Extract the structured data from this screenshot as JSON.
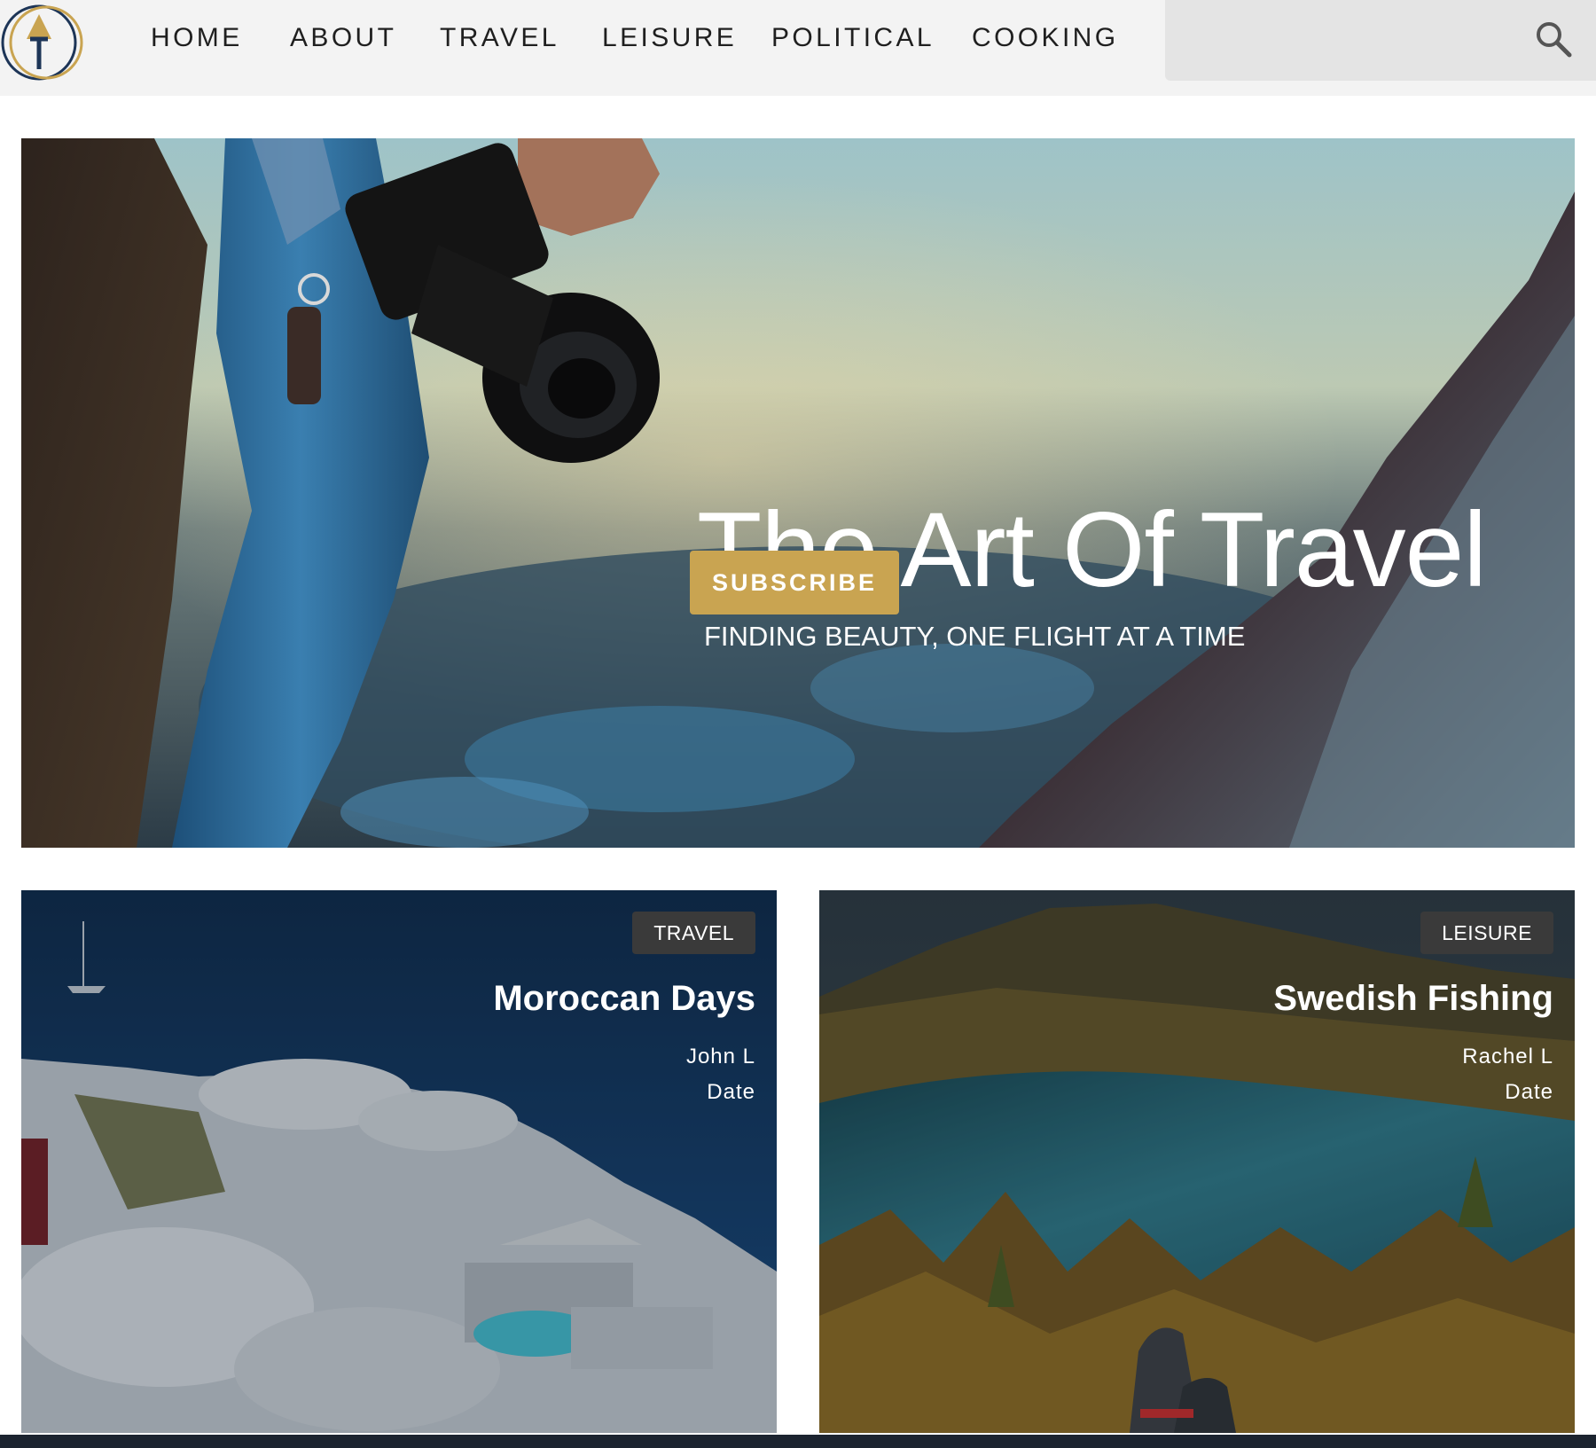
{
  "colors": {
    "accent_gold": "#c9a451",
    "logo_navy": "#1d3557",
    "nav_text": "#1f1f1f",
    "header_bg": "#f3f3f3",
    "search_bg": "#e4e4e4",
    "badge_bg": "#3a3a3a"
  },
  "header": {
    "logo_icon": "compass-t-logo",
    "nav": [
      {
        "label": "HOME"
      },
      {
        "label": "ABOUT"
      },
      {
        "label": "TRAVEL"
      },
      {
        "label": "LEISURE"
      },
      {
        "label": "POLITICAL"
      },
      {
        "label": "COOKING"
      }
    ],
    "search": {
      "placeholder": "",
      "icon": "search-icon"
    }
  },
  "hero": {
    "title": "The Art Of Travel",
    "subtitle": "FINDING BEAUTY, ONE FLIGHT AT A TIME",
    "button_label": "SUBSCRIBE"
  },
  "articles": [
    {
      "category": "TRAVEL",
      "title": "Moroccan Days",
      "author": "John L",
      "date": "Date"
    },
    {
      "category": "LEISURE",
      "title": "Swedish Fishing",
      "author": "Rachel L",
      "date": "Date"
    }
  ]
}
